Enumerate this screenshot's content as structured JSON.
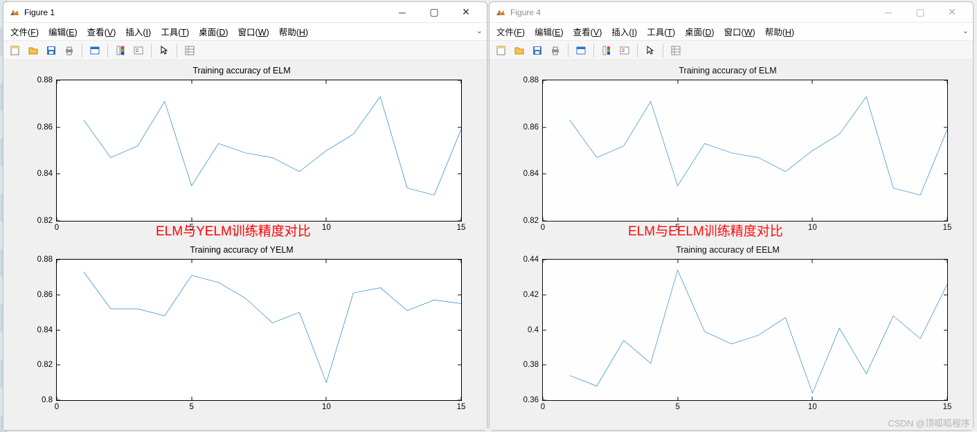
{
  "windows": {
    "fig1": {
      "title": "Figure 1",
      "redlabel": "ELM与YELM训练精度对比"
    },
    "fig4": {
      "title": "Figure 4",
      "redlabel": "ELM与EELM训练精度对比"
    }
  },
  "menu": {
    "file": "文件(F)",
    "edit": "编辑(E)",
    "view": "查看(V)",
    "insert": "插入(I)",
    "tools": "工具(T)",
    "desktop": "桌面(D)",
    "window": "窗口(W)",
    "help": "帮助(H)"
  },
  "watermark": "CSDN @顶呱呱程序",
  "chart_data": [
    {
      "id": "fig1_top",
      "type": "line",
      "title": "Training accuracy of ELM",
      "x": [
        1,
        2,
        3,
        4,
        5,
        6,
        7,
        8,
        9,
        10,
        11,
        12,
        13,
        14,
        15
      ],
      "values": [
        0.863,
        0.847,
        0.852,
        0.871,
        0.835,
        0.853,
        0.849,
        0.847,
        0.841,
        0.85,
        0.857,
        0.873,
        0.834,
        0.831,
        0.859
      ],
      "xlim": [
        0,
        15
      ],
      "ylim": [
        0.82,
        0.88
      ],
      "xticks": [
        0,
        5,
        10,
        15
      ],
      "yticks": [
        0.82,
        0.84,
        0.86,
        0.88
      ]
    },
    {
      "id": "fig1_bottom",
      "type": "line",
      "title": "Training accuracy of YELM",
      "x": [
        1,
        2,
        3,
        4,
        5,
        6,
        7,
        8,
        9,
        10,
        11,
        12,
        13,
        14,
        15
      ],
      "values": [
        0.873,
        0.852,
        0.852,
        0.848,
        0.871,
        0.867,
        0.858,
        0.844,
        0.85,
        0.81,
        0.861,
        0.864,
        0.851,
        0.857,
        0.855
      ],
      "xlim": [
        0,
        15
      ],
      "ylim": [
        0.8,
        0.88
      ],
      "xticks": [
        0,
        5,
        10,
        15
      ],
      "yticks": [
        0.8,
        0.82,
        0.84,
        0.86,
        0.88
      ]
    },
    {
      "id": "fig4_top",
      "type": "line",
      "title": "Training accuracy of ELM",
      "x": [
        1,
        2,
        3,
        4,
        5,
        6,
        7,
        8,
        9,
        10,
        11,
        12,
        13,
        14,
        15
      ],
      "values": [
        0.863,
        0.847,
        0.852,
        0.871,
        0.835,
        0.853,
        0.849,
        0.847,
        0.841,
        0.85,
        0.857,
        0.873,
        0.834,
        0.831,
        0.859
      ],
      "xlim": [
        0,
        15
      ],
      "ylim": [
        0.82,
        0.88
      ],
      "xticks": [
        0,
        5,
        10,
        15
      ],
      "yticks": [
        0.82,
        0.84,
        0.86,
        0.88
      ]
    },
    {
      "id": "fig4_bottom",
      "type": "line",
      "title": "Training accuracy of EELM",
      "x": [
        1,
        2,
        3,
        4,
        5,
        6,
        7,
        8,
        9,
        10,
        11,
        12,
        13,
        14,
        15
      ],
      "values": [
        0.374,
        0.368,
        0.394,
        0.381,
        0.434,
        0.399,
        0.392,
        0.397,
        0.407,
        0.364,
        0.401,
        0.375,
        0.408,
        0.395,
        0.426
      ],
      "xlim": [
        0,
        15
      ],
      "ylim": [
        0.36,
        0.44
      ],
      "xticks": [
        0,
        5,
        10,
        15
      ],
      "yticks": [
        0.36,
        0.38,
        0.4,
        0.42,
        0.44
      ]
    }
  ]
}
